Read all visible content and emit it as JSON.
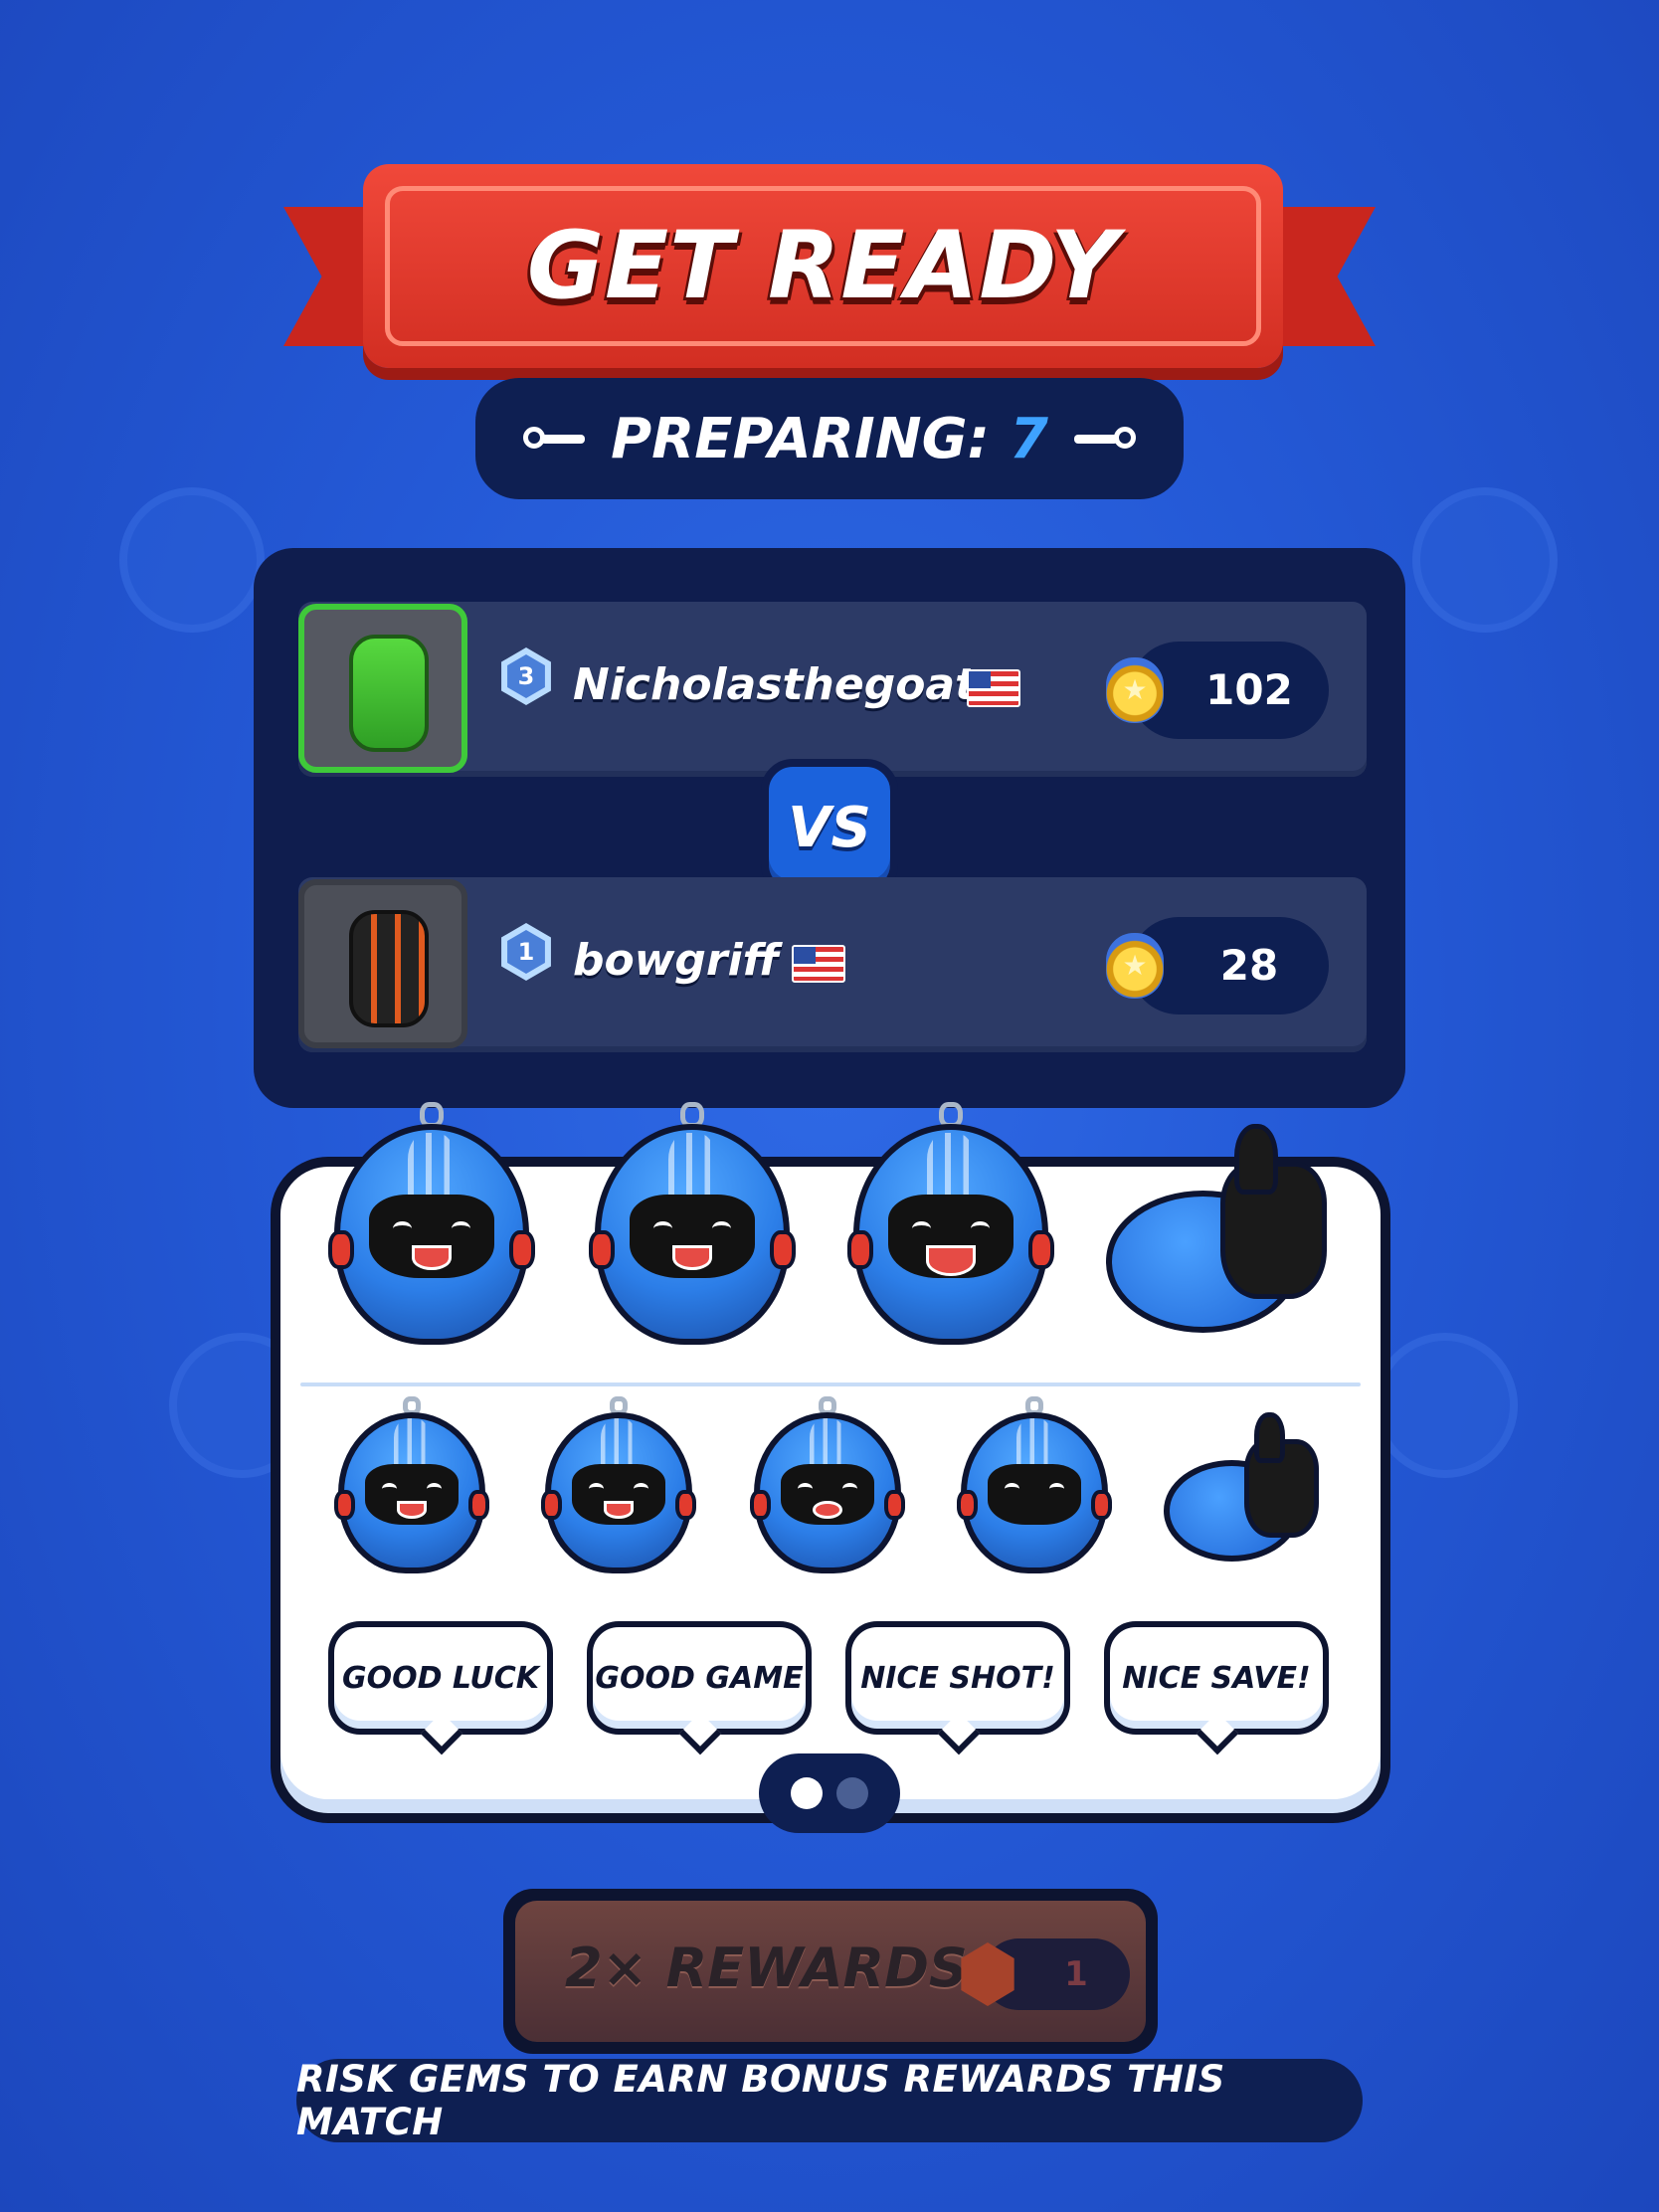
{
  "header": {
    "title": "GET READY"
  },
  "countdown": {
    "label": "PREPARING:",
    "value": "7"
  },
  "match": {
    "vs_label": "VS",
    "players": [
      {
        "level": "3",
        "name": "Nicholasthegoat",
        "country_flag": "us-flag-icon",
        "trophies": "102",
        "selected": true
      },
      {
        "level": "1",
        "name": "bowgriff",
        "country_flag": "us-flag-icon",
        "trophies": "28",
        "selected": false
      }
    ]
  },
  "emotes": {
    "chat_phrases": [
      "GOOD LUCK",
      "GOOD GAME",
      "NICE SHOT!",
      "NICE SAVE!"
    ],
    "page_count": 2,
    "current_page": 1
  },
  "rewards": {
    "label": "2× REWARDS",
    "gem_cost": "1"
  },
  "hint": "RISK GEMS TO EARN BONUS REWARDS THIS MATCH",
  "colors": {
    "background": "#2459d6",
    "banner": "#d22e22",
    "accent": "#3ea2ff",
    "panel": "#0f1d4e"
  }
}
